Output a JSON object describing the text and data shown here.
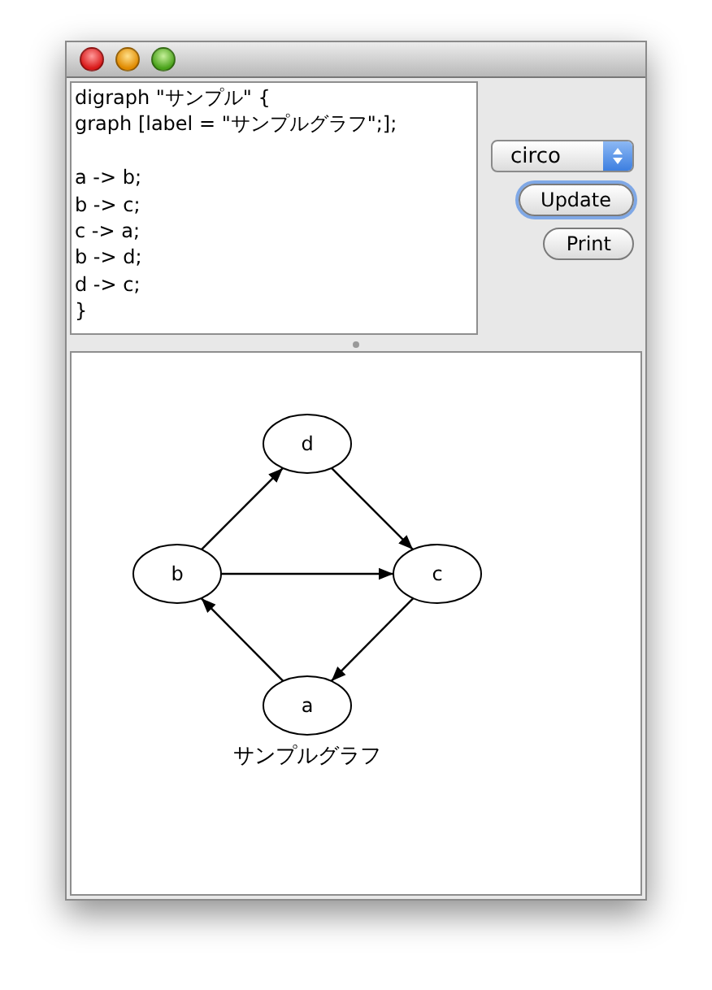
{
  "editor": {
    "value": "digraph \"サンプル\" {\ngraph [label = \"サンプルグラフ\";];\n\na -> b;\nb -> c;\nc -> a;\nb -> d;\nd -> c;\n}"
  },
  "layout_select": {
    "value": "circo"
  },
  "buttons": [
    {
      "label": "Update",
      "default": true
    },
    {
      "label": "Print",
      "default": false
    }
  ],
  "graph": {
    "nodes": [
      {
        "label": "d"
      },
      {
        "label": "b"
      },
      {
        "label": "c"
      },
      {
        "label": "a"
      }
    ],
    "label": "サンプルグラフ"
  }
}
